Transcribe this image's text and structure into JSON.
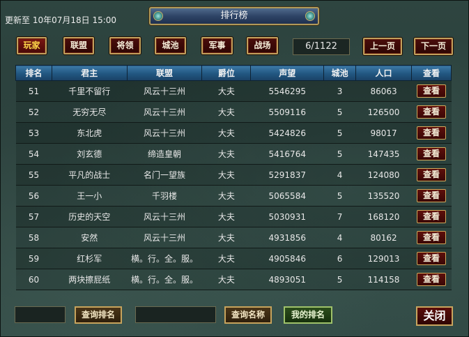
{
  "header": {
    "update_text": "更新至 10年07月18日 15:00",
    "title": "排行榜"
  },
  "tabs": [
    {
      "label": "玩家",
      "active": true
    },
    {
      "label": "联盟",
      "active": false
    },
    {
      "label": "将领",
      "active": false
    },
    {
      "label": "城池",
      "active": false
    },
    {
      "label": "军事",
      "active": false
    },
    {
      "label": "战场",
      "active": false
    }
  ],
  "pager": {
    "counter": "6/1122",
    "prev_label": "上一页",
    "next_label": "下一页"
  },
  "table": {
    "columns": [
      "排名",
      "君主",
      "联盟",
      "爵位",
      "声望",
      "城池",
      "人口",
      "查看"
    ],
    "view_label": "查看",
    "rows": [
      {
        "rank": "51",
        "lord": "千里不留行",
        "alliance": "风云十三州",
        "title": "大夫",
        "prestige": "5546295",
        "cities": "3",
        "population": "86063"
      },
      {
        "rank": "52",
        "lord": "无穷无尽",
        "alliance": "风云十三州",
        "title": "大夫",
        "prestige": "5509116",
        "cities": "5",
        "population": "126500"
      },
      {
        "rank": "53",
        "lord": "东北虎",
        "alliance": "风云十三州",
        "title": "大夫",
        "prestige": "5424826",
        "cities": "5",
        "population": "98017"
      },
      {
        "rank": "54",
        "lord": "刘玄德",
        "alliance": "缔造皇朝",
        "title": "大夫",
        "prestige": "5416764",
        "cities": "5",
        "population": "147435"
      },
      {
        "rank": "55",
        "lord": "平凡的战士",
        "alliance": "名门一望族",
        "title": "大夫",
        "prestige": "5291837",
        "cities": "4",
        "population": "124080"
      },
      {
        "rank": "56",
        "lord": "王一小",
        "alliance": "千羽楼",
        "title": "大夫",
        "prestige": "5065584",
        "cities": "5",
        "population": "135520"
      },
      {
        "rank": "57",
        "lord": "历史的天空",
        "alliance": "风云十三州",
        "title": "大夫",
        "prestige": "5030931",
        "cities": "7",
        "population": "168120"
      },
      {
        "rank": "58",
        "lord": "安然",
        "alliance": "风云十三州",
        "title": "大夫",
        "prestige": "4931856",
        "cities": "4",
        "population": "80162"
      },
      {
        "rank": "59",
        "lord": "红杉军",
        "alliance": "横。行。全。服。",
        "title": "大夫",
        "prestige": "4905846",
        "cities": "6",
        "population": "129013"
      },
      {
        "rank": "60",
        "lord": "两块擦屁纸",
        "alliance": "横。行。全。服。",
        "title": "大夫",
        "prestige": "4893051",
        "cities": "5",
        "population": "114158"
      }
    ]
  },
  "footer": {
    "search_rank_label": "查询排名",
    "search_name_label": "查询名称",
    "my_rank_label": "我的排名",
    "close_label": "关闭"
  }
}
